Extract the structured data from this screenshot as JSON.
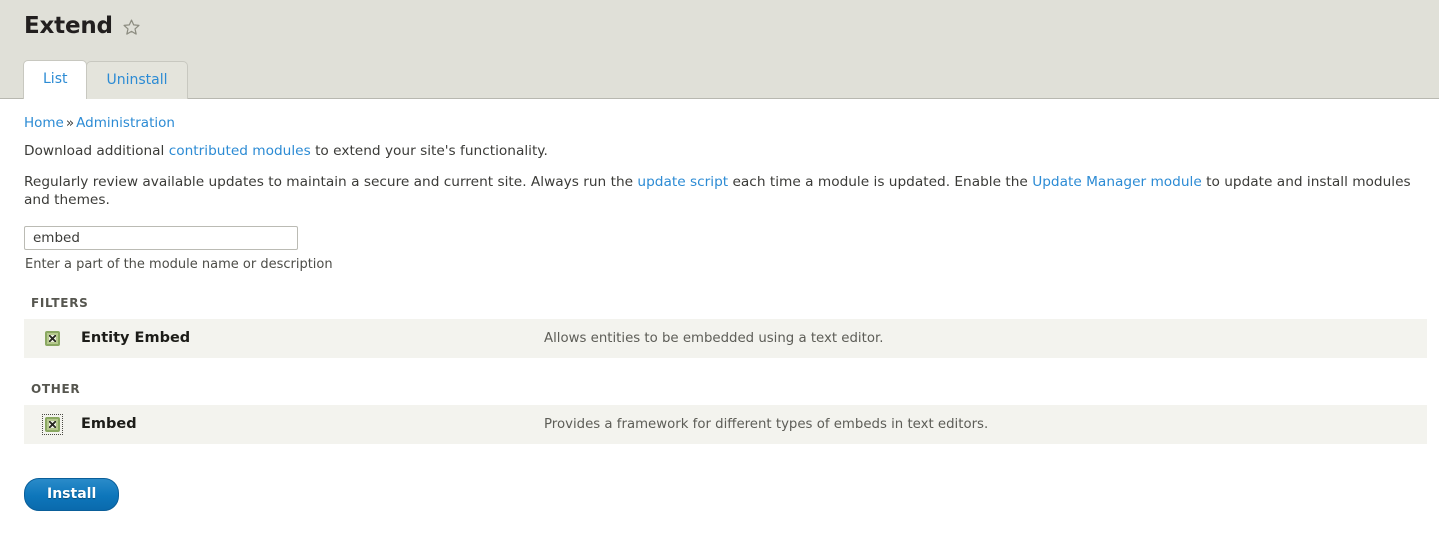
{
  "header": {
    "title": "Extend",
    "star_icon": "star-outline-icon",
    "tabs": [
      {
        "label": "List",
        "active": true
      },
      {
        "label": "Uninstall",
        "active": false
      }
    ]
  },
  "breadcrumb": {
    "items": [
      {
        "label": "Home"
      },
      {
        "label": "Administration"
      }
    ],
    "separator": "»"
  },
  "intro": {
    "line1_before": "Download additional ",
    "line1_link": "contributed modules",
    "line1_after": " to extend your site's functionality.",
    "line2_before": "Regularly review available updates to maintain a secure and current site. Always run the ",
    "line2_link1": "update script",
    "line2_middle": " each time a module is updated. Enable the ",
    "line2_link2": "Update Manager module",
    "line2_after": " to update and install modules and themes."
  },
  "search": {
    "value": "embed",
    "placeholder": "",
    "description": "Enter a part of the module name or description"
  },
  "groups": [
    {
      "title": "FILTERS",
      "modules": [
        {
          "name": "Entity Embed",
          "description": "Allows entities to be embedded using a text editor.",
          "checkbox_icon": "broken-image-icon",
          "focused": false
        }
      ]
    },
    {
      "title": "OTHER",
      "modules": [
        {
          "name": "Embed",
          "description": "Provides a framework for different types of embeds in text editors.",
          "checkbox_icon": "broken-image-icon",
          "focused": true
        }
      ]
    }
  ],
  "actions": {
    "install_label": "Install"
  },
  "colors": {
    "header_bg": "#e0e0d8",
    "row_bg": "#f3f3ee",
    "link": "#2c8bd4",
    "button_blue": "#0d76bb",
    "checkbox_green": "#8aa861"
  }
}
